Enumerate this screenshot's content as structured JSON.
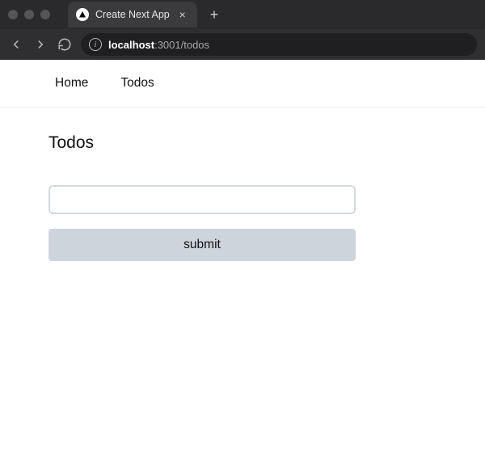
{
  "browser": {
    "tab": {
      "title": "Create Next App"
    },
    "address": {
      "host": "localhost",
      "port_path": ":3001/todos"
    }
  },
  "nav": {
    "items": [
      {
        "label": "Home"
      },
      {
        "label": "Todos"
      }
    ]
  },
  "page": {
    "title": "Todos",
    "form": {
      "input_value": "",
      "input_placeholder": "",
      "submit_label": "submit"
    }
  }
}
